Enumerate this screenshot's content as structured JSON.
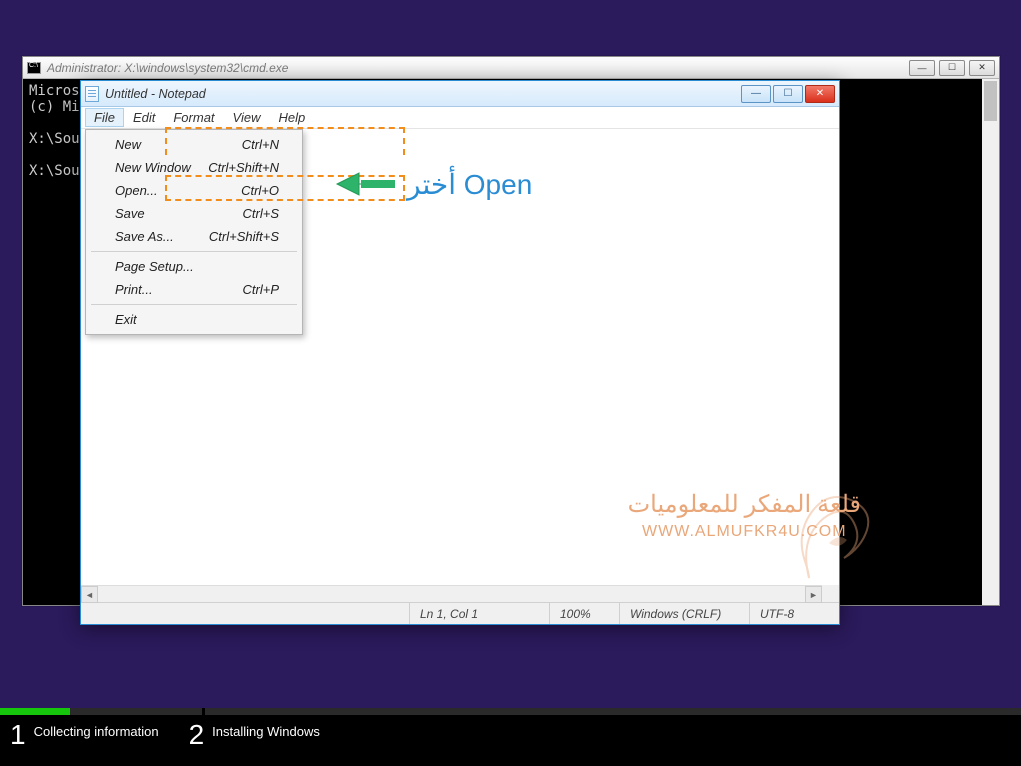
{
  "cmd": {
    "title": "Administrator: X:\\windows\\system32\\cmd.exe",
    "line1": "Microso",
    "line2": "(c) Mic",
    "line3": "X:\\Sour",
    "line4": "X:\\Sour"
  },
  "notepad": {
    "title": "Untitled - Notepad",
    "menu": {
      "file": "File",
      "edit": "Edit",
      "format": "Format",
      "view": "View",
      "help": "Help"
    },
    "file_menu": [
      {
        "label": "New",
        "shortcut": "Ctrl+N"
      },
      {
        "label": "New Window",
        "shortcut": "Ctrl+Shift+N"
      },
      {
        "label": "Open...",
        "shortcut": "Ctrl+O"
      },
      {
        "label": "Save",
        "shortcut": "Ctrl+S"
      },
      {
        "label": "Save As...",
        "shortcut": "Ctrl+Shift+S"
      },
      {
        "label": "Page Setup...",
        "shortcut": ""
      },
      {
        "label": "Print...",
        "shortcut": "Ctrl+P"
      },
      {
        "label": "Exit",
        "shortcut": ""
      }
    ],
    "status": {
      "pos": "Ln 1, Col 1",
      "zoom": "100%",
      "eol": "Windows (CRLF)",
      "enc": "UTF-8"
    }
  },
  "annotation": {
    "text": "أختر Open"
  },
  "watermark": {
    "ar": "قلعة المفكر للمعلوميات",
    "url": "WWW.ALMUFKR4U.COM"
  },
  "setup": {
    "step1_num": "1",
    "step1_label": "Collecting information",
    "step2_num": "2",
    "step2_label": "Installing Windows"
  }
}
